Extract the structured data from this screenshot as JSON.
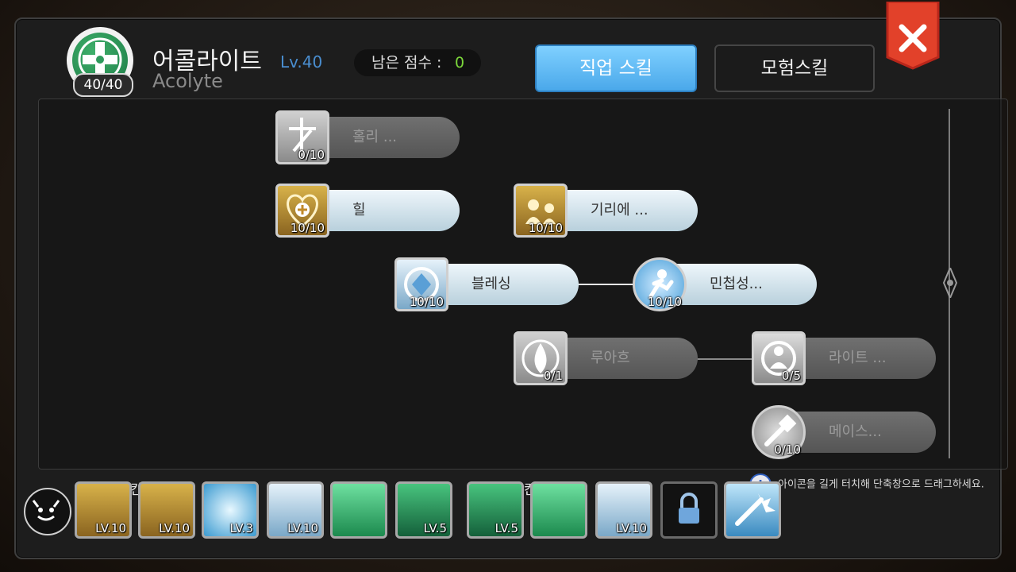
{
  "header": {
    "job_name": "어콜라이트",
    "job_level": "Lv.40",
    "job_english": "Acolyte",
    "job_points": "40/40",
    "remaining_label": "남은 점수 :",
    "remaining_value": "0"
  },
  "tabs": {
    "job_skill": "직업 스킬",
    "adventure_skill": "모험스킬"
  },
  "skills": [
    {
      "name": "홀리 ...",
      "level": "0/10",
      "state": "off",
      "icon": "holy-light-icon"
    },
    {
      "name": "힐",
      "level": "10/10",
      "state": "on",
      "icon": "heal-icon"
    },
    {
      "name": "기리에 ...",
      "level": "10/10",
      "state": "on",
      "icon": "kyrie-eleison-icon"
    },
    {
      "name": "블레싱",
      "level": "10/10",
      "state": "on",
      "icon": "blessing-icon"
    },
    {
      "name": "민첩성...",
      "level": "10/10",
      "state": "on",
      "icon": "increase-agility-icon"
    },
    {
      "name": "루아흐",
      "level": "0/1",
      "state": "off",
      "icon": "ruwach-icon"
    },
    {
      "name": "라이트 ...",
      "level": "0/5",
      "state": "off",
      "icon": "light-skill-icon"
    },
    {
      "name": "메이스...",
      "level": "0/10",
      "state": "off",
      "icon": "mace-mastery-icon"
    }
  ],
  "manual_slots_label": "수동 스킬칸",
  "auto_slots_label": "자동 스킬칸",
  "hint": "아이콘을 길게 터치해 단축창으로 드래그하세요.",
  "manual_slots": [
    {
      "level": "LV.10",
      "icon": "kyrie-eleison-icon"
    },
    {
      "level": "LV.10",
      "icon": "heal-icon"
    },
    {
      "level": "LV.3",
      "icon": "sun-icon"
    },
    {
      "level": "LV.10",
      "icon": "blessing-icon"
    },
    {
      "level": "",
      "icon": "green-figure-icon"
    },
    {
      "level": "LV.5",
      "icon": "green-flame-icon"
    }
  ],
  "auto_slots": [
    {
      "level": "LV.5",
      "icon": "green-flame-icon"
    },
    {
      "level": "",
      "icon": "green-figure-icon"
    },
    {
      "level": "LV.10",
      "icon": "blessing-icon"
    },
    {
      "level": "",
      "icon": "lock-icon"
    },
    {
      "level": "",
      "icon": "sword-strike-icon"
    }
  ],
  "colors": {
    "accent_blue": "#4aa8ea",
    "points_green": "#7cd83b",
    "close_red": "#e2412a"
  }
}
